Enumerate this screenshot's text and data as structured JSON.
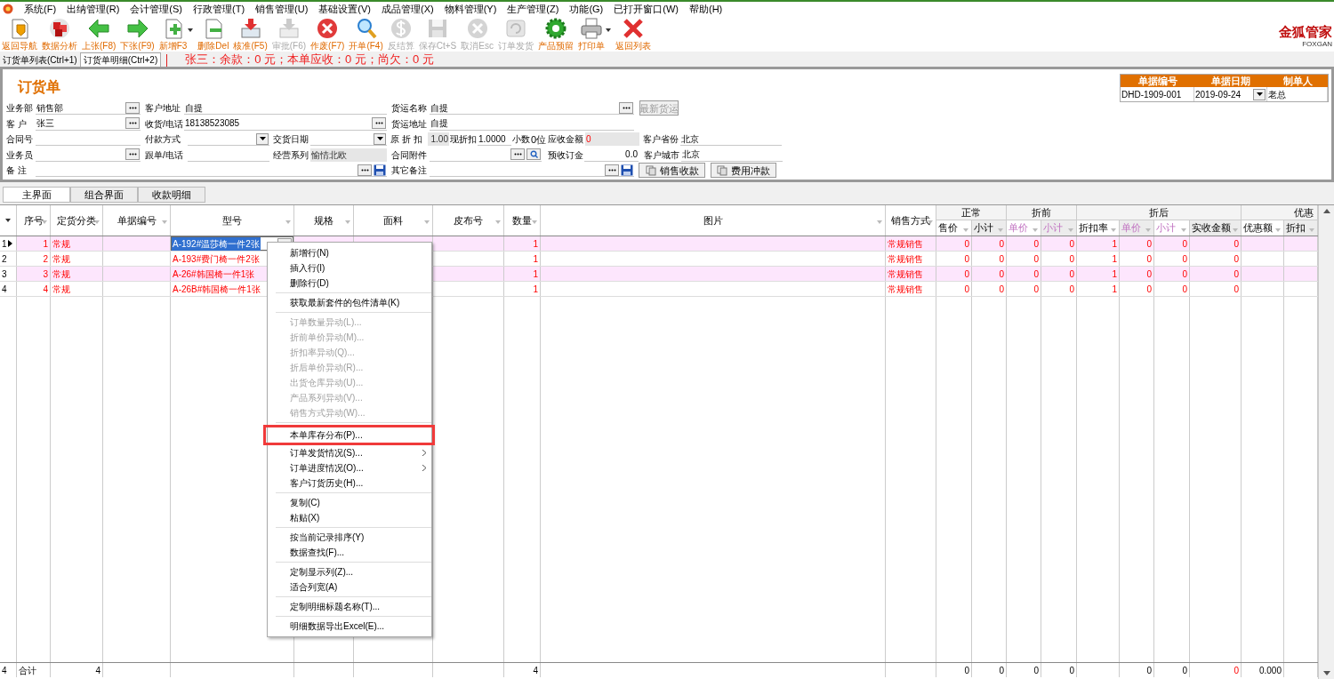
{
  "menu_bar": [
    "系统(F)",
    "出纳管理(R)",
    "会计管理(S)",
    "行政管理(T)",
    "销售管理(U)",
    "基础设置(V)",
    "成品管理(X)",
    "物料管理(Y)",
    "生产管理(Z)",
    "功能(G)",
    "已打开窗口(W)",
    "帮助(H)"
  ],
  "toolbar": [
    {
      "label": "返回导航",
      "disabled": false,
      "dropdown": false
    },
    {
      "label": "数据分析",
      "disabled": false,
      "dropdown": false
    },
    {
      "label": "上张(F8)",
      "disabled": false,
      "dropdown": false
    },
    {
      "label": "下张(F9)",
      "disabled": false,
      "dropdown": false
    },
    {
      "label": "新增F3",
      "disabled": false,
      "dropdown": true
    },
    {
      "label": "删除Del",
      "disabled": false,
      "dropdown": false
    },
    {
      "label": "核准(F5)",
      "disabled": false,
      "dropdown": false
    },
    {
      "label": "审批(F6)",
      "disabled": true,
      "dropdown": false
    },
    {
      "label": "作废(F7)",
      "disabled": false,
      "dropdown": false
    },
    {
      "label": "开单(F4)",
      "disabled": false,
      "dropdown": false
    },
    {
      "label": "反结算",
      "disabled": true,
      "dropdown": false
    },
    {
      "label": "保存Ct+S",
      "disabled": true,
      "dropdown": false
    },
    {
      "label": "取消Esc",
      "disabled": true,
      "dropdown": false
    },
    {
      "label": "订单发货",
      "disabled": true,
      "dropdown": false
    },
    {
      "label": "产品预留",
      "disabled": false,
      "dropdown": false
    },
    {
      "label": "打印单",
      "disabled": false,
      "dropdown": true
    },
    {
      "label": "返回列表",
      "disabled": false,
      "dropdown": false
    }
  ],
  "logo": {
    "title": "金狐管家",
    "subtitle": "FOXGAN"
  },
  "page_tabs": [
    {
      "label": "订货单列表(Ctrl+1)",
      "selected": false
    },
    {
      "label": "订货单明细(Ctrl+2)",
      "selected": true
    }
  ],
  "status": "张三：余款：0 元；本单应收：0 元；尚欠：0 元",
  "form": {
    "title": "订货单",
    "fields": [
      {
        "label": "业务部",
        "value": "销售部",
        "kind": "lookup"
      },
      {
        "label": "客户地址",
        "value": "自提",
        "kind": "text"
      },
      {
        "label": "货运名称",
        "value": "自提",
        "kind": "lookup"
      },
      {
        "label": "最新货运",
        "kind": "button",
        "disabled": true
      },
      {
        "label": "客 户",
        "value": "张三",
        "kind": "lookup"
      },
      {
        "label": "收货/电话",
        "value": "18138523085",
        "kind": "lookup"
      },
      {
        "label": "货运地址",
        "value": "自提",
        "kind": "text"
      },
      {
        "label": "合同号",
        "kind": "text"
      },
      {
        "label": "付款方式",
        "kind": "dropdown"
      },
      {
        "label": "交货日期",
        "kind": "dropdown"
      },
      {
        "label": "原 折 扣",
        "value": "1.00",
        "kind": "readonly"
      },
      {
        "label": "现折扣",
        "value": "1.0000",
        "kind": "text"
      },
      {
        "label": "小数",
        "value": "0位",
        "kind": "plain"
      },
      {
        "label": "应收金额",
        "value": "0",
        "kind": "amount"
      },
      {
        "label": "客户省份",
        "value": "北京",
        "kind": "text"
      },
      {
        "label": "业务员",
        "kind": "lookup"
      },
      {
        "label": "跟单/电话",
        "kind": "text"
      },
      {
        "label": "经营系列",
        "value": "愉情北欧",
        "kind": "readonly"
      },
      {
        "label": "合同附件",
        "kind": "attach"
      },
      {
        "label": "预收订金",
        "value": "0.0",
        "kind": "number"
      },
      {
        "label": "客户城市",
        "value": "北京",
        "kind": "text"
      },
      {
        "label": "备 注",
        "kind": "memo"
      },
      {
        "label": "其它备注",
        "kind": "memo"
      },
      {
        "label": "销售收款",
        "kind": "icon_button",
        "disabled": false
      },
      {
        "label": "费用冲款",
        "kind": "icon_button",
        "disabled": false
      }
    ]
  },
  "document_info": {
    "columns": [
      "单据编号",
      "单据日期",
      "制单人"
    ],
    "values": [
      "DHD-1909-001",
      "2019-09-24",
      "老总"
    ]
  },
  "sub_tabs": [
    {
      "label": "主界面",
      "selected": true
    },
    {
      "label": "组合界面",
      "selected": false
    },
    {
      "label": "收款明细",
      "selected": false
    }
  ],
  "grid": {
    "column_groups": [
      {
        "label": "正常"
      },
      {
        "label": "折前"
      },
      {
        "label": "折后"
      },
      {
        "label": "优惠"
      }
    ],
    "columns": [
      {
        "label": "序号",
        "disabled": false
      },
      {
        "label": "定货分类",
        "disabled": false
      },
      {
        "label": "单据编号",
        "disabled": false
      },
      {
        "label": "型号",
        "disabled": false
      },
      {
        "label": "规格",
        "disabled": false
      },
      {
        "label": "面料",
        "disabled": false
      },
      {
        "label": "皮布号",
        "disabled": false
      },
      {
        "label": "数量",
        "disabled": false
      },
      {
        "label": "图片",
        "disabled": false
      },
      {
        "label": "销售方式",
        "disabled": false
      },
      {
        "label": "售价",
        "disabled": false
      },
      {
        "label": "小计",
        "disabled": false
      },
      {
        "label": "单价",
        "disabled": true
      },
      {
        "label": "小计",
        "disabled": true
      },
      {
        "label": "折扣率",
        "disabled": false
      },
      {
        "label": "单价",
        "disabled": true
      },
      {
        "label": "小计",
        "disabled": true
      },
      {
        "label": "实收金额",
        "disabled": false
      },
      {
        "label": "优惠额",
        "disabled": false
      },
      {
        "label": "折扣",
        "disabled": false
      }
    ],
    "rows": [
      {
        "number": "1",
        "selected": true,
        "cells": [
          "1",
          "常规",
          null,
          "A-192#温莎椅一件2张",
          null,
          null,
          null,
          "1",
          null,
          "常规销售",
          "0",
          "0",
          "0",
          "0",
          "1",
          "0",
          "0",
          "0",
          null,
          null
        ]
      },
      {
        "number": "2",
        "selected": false,
        "cells": [
          "2",
          "常规",
          null,
          "A-193#费门椅一件2张",
          null,
          null,
          null,
          "1",
          null,
          "常规销售",
          "0",
          "0",
          "0",
          "0",
          "1",
          "0",
          "0",
          "0",
          null,
          null
        ]
      },
      {
        "number": "3",
        "selected": false,
        "cells": [
          "3",
          "常规",
          null,
          "A-26#韩国椅一件1张",
          null,
          null,
          null,
          "1",
          null,
          "常规销售",
          "0",
          "0",
          "0",
          "0",
          "1",
          "0",
          "0",
          "0",
          null,
          null
        ]
      },
      {
        "number": "4",
        "selected": false,
        "cells": [
          "4",
          "常规",
          null,
          "A-26B#韩国椅一件1张",
          null,
          null,
          null,
          "1",
          null,
          "常规销售",
          "0",
          "0",
          "0",
          "0",
          "1",
          "0",
          "0",
          "0",
          null,
          null
        ]
      }
    ],
    "total": {
      "number": "4",
      "cells": [
        "合计",
        "4",
        null,
        null,
        null,
        null,
        null,
        "4",
        null,
        null,
        "0",
        "0",
        "0",
        "0",
        null,
        "0",
        "0",
        {
          "text": "0",
          "alert": true
        },
        "0.000",
        null
      ]
    }
  },
  "context_menu": {
    "groups": [
      [
        {
          "label": "新增行(N)",
          "disabled": false,
          "submenu": false,
          "highlighted": false
        },
        {
          "label": "插入行(I)",
          "disabled": false,
          "submenu": false,
          "highlighted": false
        },
        {
          "label": "删除行(D)",
          "disabled": false,
          "submenu": false,
          "highlighted": false
        }
      ],
      [
        {
          "label": "获取最新套件的包件清单(K)",
          "disabled": false,
          "submenu": false,
          "highlighted": false
        }
      ],
      [
        {
          "label": "订单数量异动(L)...",
          "disabled": true,
          "submenu": false,
          "highlighted": false
        },
        {
          "label": "折前单价异动(M)...",
          "disabled": true,
          "submenu": false,
          "highlighted": false
        },
        {
          "label": "折扣率异动(Q)...",
          "disabled": true,
          "submenu": false,
          "highlighted": false
        },
        {
          "label": "折后单价异动(R)...",
          "disabled": true,
          "submenu": false,
          "highlighted": false
        },
        {
          "label": "出货仓库异动(U)...",
          "disabled": true,
          "submenu": false,
          "highlighted": false
        },
        {
          "label": "产品系列异动(V)...",
          "disabled": true,
          "submenu": false,
          "highlighted": false
        },
        {
          "label": "销售方式异动(W)...",
          "disabled": true,
          "submenu": false,
          "highlighted": false
        }
      ],
      [
        {
          "label": "本单库存分布(P)...",
          "disabled": false,
          "submenu": false,
          "highlighted": true
        },
        {
          "label": "订单发货情况(S)...",
          "disabled": false,
          "submenu": true,
          "highlighted": false
        },
        {
          "label": "订单进度情况(O)...",
          "disabled": false,
          "submenu": true,
          "highlighted": false
        },
        {
          "label": "客户订货历史(H)...",
          "disabled": false,
          "submenu": false,
          "highlighted": false
        }
      ],
      [
        {
          "label": "复制(C)",
          "disabled": false,
          "submenu": false,
          "highlighted": false
        },
        {
          "label": "粘贴(X)",
          "disabled": false,
          "submenu": false,
          "highlighted": false
        }
      ],
      [
        {
          "label": "按当前记录排序(Y)",
          "disabled": false,
          "submenu": false,
          "highlighted": false
        },
        {
          "label": "数据查找(F)...",
          "disabled": false,
          "submenu": false,
          "highlighted": false
        }
      ],
      [
        {
          "label": "定制显示列(Z)...",
          "disabled": false,
          "submenu": false,
          "highlighted": false
        },
        {
          "label": "适合列宽(A)",
          "disabled": false,
          "submenu": false,
          "highlighted": false
        }
      ],
      [
        {
          "label": "定制明细标题名称(T)...",
          "disabled": false,
          "submenu": false,
          "highlighted": false
        }
      ],
      [
        {
          "label": "明细数据导出Excel(E)...",
          "disabled": false,
          "submenu": false,
          "highlighted": false
        }
      ]
    ]
  }
}
